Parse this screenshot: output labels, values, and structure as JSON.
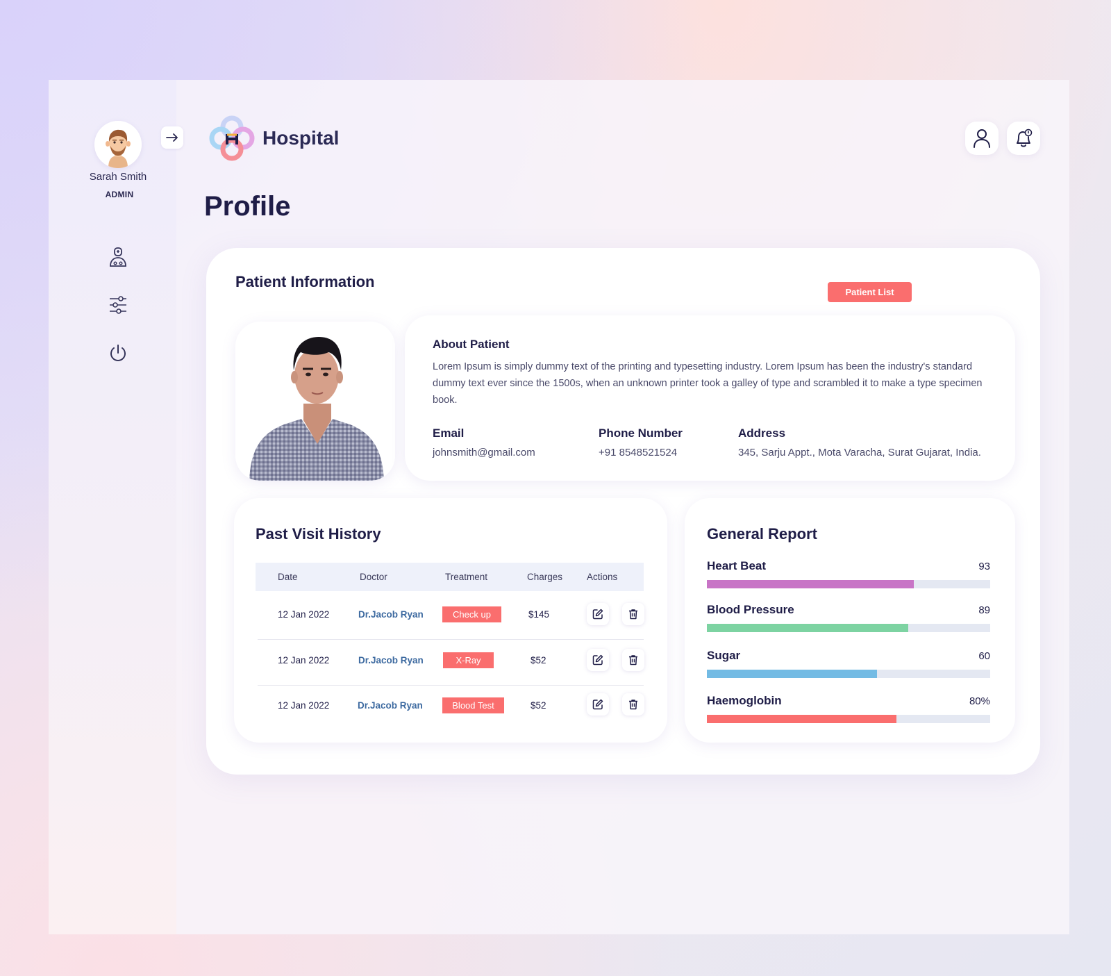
{
  "user": {
    "name": "Sarah Smith",
    "role": "ADMIN"
  },
  "brand": {
    "name": "Hospital"
  },
  "page": {
    "title": "Profile"
  },
  "patient_info": {
    "title": "Patient Information",
    "list_button": "Patient List",
    "about_title": "About Patient",
    "about_text": "Lorem Ipsum is simply dummy text of the printing and typesetting industry. Lorem Ipsum has been the industry's standard dummy text ever since the 1500s, when an unknown printer took a galley of type and scrambled it to make a type specimen book.",
    "email_label": "Email",
    "email": "johnsmith@gmail.com",
    "phone_label": "Phone Number",
    "phone": "+91 8548521524",
    "address_label": "Address",
    "address": "345, Sarju Appt., Mota Varacha, Surat Gujarat, India."
  },
  "history": {
    "title": "Past Visit History",
    "columns": [
      "Date",
      "Doctor",
      "Treatment",
      "Charges",
      "Actions"
    ],
    "rows": [
      {
        "date": "12 Jan 2022",
        "doctor": "Dr.Jacob Ryan",
        "treatment": "Check up",
        "charges": "$145"
      },
      {
        "date": "12 Jan 2022",
        "doctor": "Dr.Jacob Ryan",
        "treatment": "X-Ray",
        "charges": "$52"
      },
      {
        "date": "12 Jan 2022",
        "doctor": "Dr.Jacob Ryan",
        "treatment": "Blood Test",
        "charges": "$52"
      }
    ]
  },
  "report": {
    "title": "General Report",
    "metrics": [
      {
        "label": "Heart Beat",
        "value": "93",
        "fraction": 0.73,
        "color": "#c874c6"
      },
      {
        "label": "Blood Pressure",
        "value": "89",
        "fraction": 0.71,
        "color": "#7dd3a2"
      },
      {
        "label": "Sugar",
        "value": "60",
        "fraction": 0.6,
        "color": "#73bbe4"
      },
      {
        "label": "Haemoglobin",
        "value": "80%",
        "fraction": 0.67,
        "color": "#fa6e6e"
      }
    ]
  },
  "icons": {
    "collapse": "arrow-right-icon",
    "nav": [
      "doctor-icon",
      "sliders-icon",
      "power-icon"
    ],
    "top": [
      "user-icon",
      "bell-icon"
    ],
    "row_actions": [
      "edit-icon",
      "trash-icon"
    ]
  },
  "colors": {
    "accent": "#fa6e6e",
    "primary_text": "#1f1d47",
    "doctor_link": "#3d6aa0"
  }
}
